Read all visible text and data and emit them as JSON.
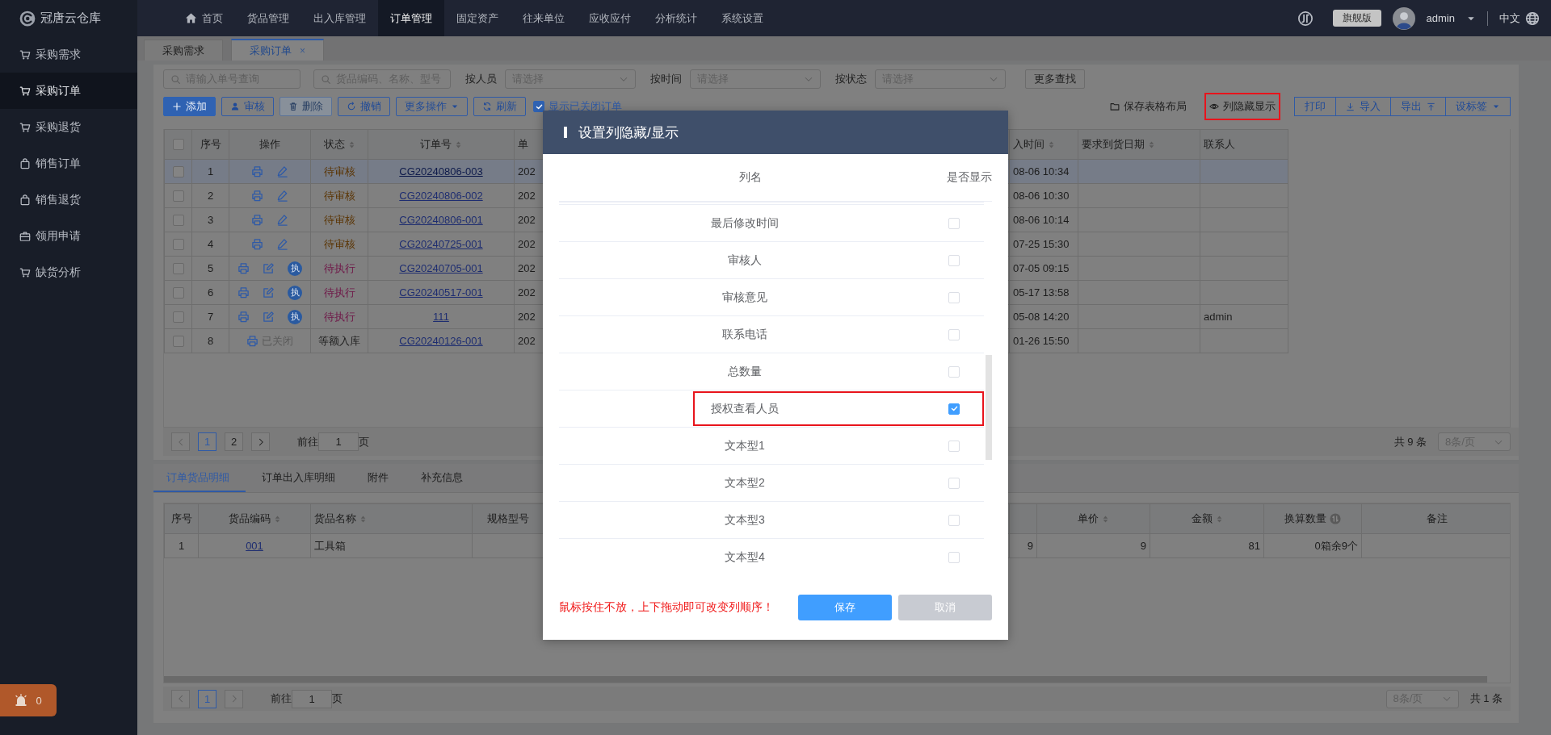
{
  "app": {
    "logo_text": "冠唐云仓库"
  },
  "top_nav": [
    {
      "label": "首页",
      "kind": "home",
      "selected": false
    },
    {
      "label": "货品管理",
      "kind": "plain",
      "selected": false
    },
    {
      "label": "出入库管理",
      "kind": "plain",
      "selected": false
    },
    {
      "label": "订单管理",
      "kind": "plain",
      "selected": true
    },
    {
      "label": "固定资产",
      "kind": "plain",
      "selected": false
    },
    {
      "label": "往来单位",
      "kind": "plain",
      "selected": false
    },
    {
      "label": "应收应付",
      "kind": "plain",
      "selected": false
    },
    {
      "label": "分析统计",
      "kind": "plain",
      "selected": false
    },
    {
      "label": "系统设置",
      "kind": "plain",
      "selected": false
    }
  ],
  "header_right": {
    "edition": "旗舰版",
    "user": "admin",
    "language": "中文"
  },
  "sidebar": {
    "items": [
      {
        "label": "采购需求",
        "kind": "purchase",
        "selected": false
      },
      {
        "label": "采购订单",
        "kind": "purchase",
        "selected": true
      },
      {
        "label": "采购退货",
        "kind": "purchase",
        "selected": false
      },
      {
        "label": "销售订单",
        "kind": "sales",
        "selected": false
      },
      {
        "label": "销售退货",
        "kind": "sales",
        "selected": false
      },
      {
        "label": "领用申请",
        "kind": "requisition",
        "selected": false
      },
      {
        "label": "缺货分析",
        "kind": "purchase",
        "selected": false
      }
    ],
    "alert_count": "0"
  },
  "page_tabs": [
    {
      "label": "采购需求",
      "selected": false
    },
    {
      "label": "采购订单",
      "selected": true,
      "close": "×"
    }
  ],
  "filters": {
    "searches": [
      {
        "placeholder": "请输入单号查询"
      },
      {
        "placeholder": "货品编码、名称、型号"
      }
    ],
    "selects": [
      {
        "label": "按人员",
        "placeholder": "请选择"
      },
      {
        "label": "按时间",
        "placeholder": "请选择"
      },
      {
        "label": "按状态",
        "placeholder": "请选择"
      }
    ],
    "more_button": "更多查找"
  },
  "toolbar": {
    "buttons": [
      {
        "label": "添加",
        "kind": "add",
        "disabled": false
      },
      {
        "label": "审核",
        "kind": "approve",
        "disabled": false
      },
      {
        "label": "删除",
        "kind": "delete",
        "disabled": true
      },
      {
        "label": "撤销",
        "kind": "revoke",
        "disabled": false
      },
      {
        "label": "更多操作",
        "kind": "more",
        "disabled": false
      },
      {
        "label": "刷新",
        "kind": "refresh",
        "disabled": false
      }
    ],
    "show_closed": {
      "label": "显示已关闭订单",
      "checked": true
    },
    "links": [
      {
        "label": "保存表格布局",
        "kind": "save_layout",
        "highlighted": false
      },
      {
        "label": "列隐藏显示",
        "kind": "columns",
        "highlighted": true
      }
    ],
    "group": [
      {
        "label": "打印",
        "kind": "print"
      },
      {
        "label": "导入",
        "kind": "import"
      },
      {
        "label": "导出",
        "kind": "export"
      },
      {
        "label": "设标签",
        "kind": "tag"
      }
    ]
  },
  "orders_table": {
    "select_all_checked": false,
    "columns": [
      {
        "kind": "check"
      },
      {
        "kind": "text",
        "label": "序号"
      },
      {
        "kind": "actions",
        "label": "操作"
      },
      {
        "kind": "status",
        "label": "状态",
        "sortable": true
      },
      {
        "kind": "link",
        "label": "订单号",
        "sortable": true
      },
      {
        "kind": "text",
        "label": "单"
      },
      {
        "kind": "covered"
      },
      {
        "kind": "text",
        "label": "入时间",
        "sortable": true
      },
      {
        "kind": "text",
        "label": "要求到货日期",
        "sortable": true
      },
      {
        "kind": "text",
        "label": "联系人"
      }
    ],
    "rows": [
      {
        "selected": true,
        "checked": false,
        "index": "1",
        "actions": [
          {
            "kind": "print"
          },
          {
            "kind": "edit"
          }
        ],
        "status": {
          "text": "待审核",
          "color": "#5a3300"
        },
        "order_no": "CG20240806-003",
        "column_6": "202",
        "column_8": "08-06 10:34"
      },
      {
        "selected": false,
        "checked": false,
        "index": "2",
        "actions": [
          {
            "kind": "print"
          },
          {
            "kind": "edit"
          }
        ],
        "status": {
          "text": "待审核",
          "color": "#5a3300"
        },
        "order_no": "CG20240806-002",
        "column_6": "202",
        "column_8": "08-06 10:30"
      },
      {
        "selected": false,
        "checked": false,
        "index": "3",
        "actions": [
          {
            "kind": "print"
          },
          {
            "kind": "edit"
          }
        ],
        "status": {
          "text": "待审核",
          "color": "#5a3300"
        },
        "order_no": "CG20240806-001",
        "column_6": "202",
        "column_8": "08-06 10:14"
      },
      {
        "selected": false,
        "checked": false,
        "index": "4",
        "actions": [
          {
            "kind": "print"
          },
          {
            "kind": "edit"
          }
        ],
        "status": {
          "text": "待审核",
          "color": "#5a3300"
        },
        "order_no": "CG20240725-001",
        "column_6": "202",
        "column_8": "07-25 15:30"
      },
      {
        "selected": false,
        "checked": false,
        "index": "5",
        "actions": [
          {
            "kind": "print"
          },
          {
            "kind": "edit_form"
          },
          {
            "kind": "execute",
            "label": "执"
          }
        ],
        "status": {
          "text": "待执行",
          "color": "#6e1446"
        },
        "order_no": "CG20240705-001",
        "column_6": "202",
        "column_8": "07-05 09:15"
      },
      {
        "selected": false,
        "checked": false,
        "index": "6",
        "actions": [
          {
            "kind": "print"
          },
          {
            "kind": "edit_form"
          },
          {
            "kind": "execute",
            "label": "执"
          }
        ],
        "status": {
          "text": "待执行",
          "color": "#6e1446"
        },
        "order_no": "CG20240517-001",
        "column_6": "202",
        "column_8": "05-17 13:58"
      },
      {
        "selected": false,
        "checked": false,
        "index": "7",
        "actions": [
          {
            "kind": "print"
          },
          {
            "kind": "edit_form"
          },
          {
            "kind": "execute",
            "label": "执"
          }
        ],
        "status": {
          "text": "待执行",
          "color": "#6e1446"
        },
        "order_no": "111",
        "column_6": "202",
        "column_8": "05-08 14:20",
        "contact": "admin"
      },
      {
        "selected": false,
        "checked": false,
        "index": "8",
        "actions": [
          {
            "kind": "print"
          },
          {
            "kind": "closed",
            "label": "已关闭"
          }
        ],
        "status": {
          "text": "等额入库",
          "color": "#1c1c1c"
        },
        "order_no": "CG20240126-001",
        "column_6": "202",
        "column_8": "01-26 15:50"
      }
    ]
  },
  "orders_pagination": {
    "prev_disabled": true,
    "next_disabled": false,
    "pages": [
      {
        "label": "1",
        "selected": true
      },
      {
        "label": "2",
        "selected": false
      }
    ],
    "goto_label": "前往",
    "goto_value": "1",
    "page_suffix": "页",
    "total": "共 9 条",
    "page_size": "8条/页"
  },
  "detail_tabs": [
    {
      "label": "订单货品明细",
      "selected": true
    },
    {
      "label": "订单出入库明细",
      "selected": false
    },
    {
      "label": "附件",
      "selected": false
    },
    {
      "label": "补充信息",
      "selected": false
    }
  ],
  "detail_table": {
    "columns": [
      {
        "kind": "text",
        "label": "序号"
      },
      {
        "kind": "link",
        "label": "货品编码",
        "sortable": true
      },
      {
        "kind": "text",
        "label": "货品名称",
        "sortable": true
      },
      {
        "kind": "text",
        "label": "规格型号"
      },
      {
        "kind": "covered"
      },
      {
        "kind": "text"
      },
      {
        "kind": "text",
        "label": "单价",
        "sortable": true
      },
      {
        "kind": "text",
        "label": "金额",
        "sortable": true
      },
      {
        "kind": "text",
        "label": "换算数量",
        "info": true
      },
      {
        "kind": "text",
        "label": "备注"
      }
    ],
    "rows": [
      {
        "index": "1",
        "code": "001",
        "name": "工具箱",
        "quantity": "9",
        "price": "9",
        "amount": "81",
        "converted": "0箱余9个"
      }
    ]
  },
  "detail_pagination": {
    "prev_disabled": true,
    "next_disabled": true,
    "pages": [
      {
        "label": "1",
        "selected": true
      }
    ],
    "goto_label": "前往",
    "goto_value": "1",
    "page_suffix": "页",
    "total": "共 1 条",
    "page_size": "8条/页"
  },
  "column_dialog": {
    "title": "设置列隐藏/显示",
    "header_name": "列名",
    "header_show": "是否显示",
    "rows": [
      {
        "label": "最后修改时间",
        "checked": false,
        "highlighted": false
      },
      {
        "label": "审核人",
        "checked": false,
        "highlighted": false
      },
      {
        "label": "审核意见",
        "checked": false,
        "highlighted": false
      },
      {
        "label": "联系电话",
        "checked": false,
        "highlighted": false
      },
      {
        "label": "总数量",
        "checked": false,
        "highlighted": false
      },
      {
        "label": "授权查看人员",
        "checked": true,
        "highlighted": true
      },
      {
        "label": "文本型1",
        "checked": false,
        "highlighted": false
      },
      {
        "label": "文本型2",
        "checked": false,
        "highlighted": false
      },
      {
        "label": "文本型3",
        "checked": false,
        "highlighted": false
      },
      {
        "label": "文本型4",
        "checked": false,
        "highlighted": false
      }
    ],
    "hint": "鼠标按住不放，上下拖动即可改变列顺序！",
    "buttons": [
      {
        "label": "保存",
        "kind": "primary"
      },
      {
        "label": "取消",
        "kind": "secondary"
      }
    ]
  }
}
